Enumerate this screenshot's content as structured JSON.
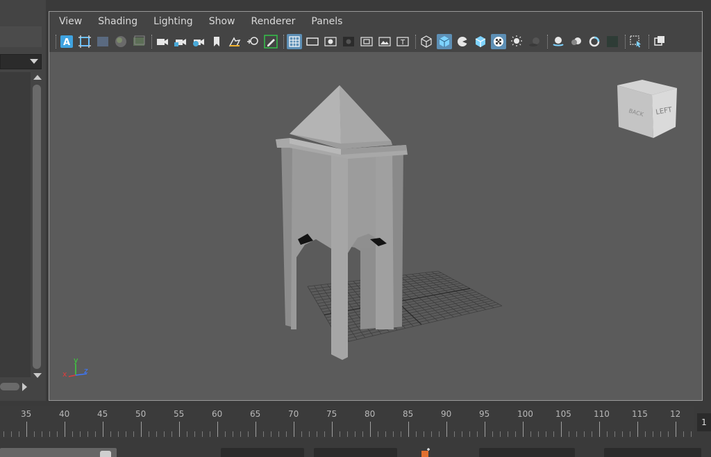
{
  "panel_menu": {
    "items": [
      "View",
      "Shading",
      "Lighting",
      "Show",
      "Renderer",
      "Panels"
    ]
  },
  "panel_toolbar": {
    "icons": [
      "select-camera-icon",
      "camera-attributes-icon",
      "bookmarks-icon",
      "image-plane-icon",
      "2d-pan-zoom-icon",
      "grease-pencil-icon",
      "grid-icon",
      "film-gate-icon",
      "resolution-gate-icon",
      "gate-mask-icon",
      "field-chart-icon",
      "safe-action-icon",
      "safe-title-icon",
      "wireframe-icon",
      "smooth-shade-icon",
      "use-default-material-icon",
      "wireframe-on-shaded-icon",
      "textured-icon",
      "use-all-lights-icon",
      "shadows-icon",
      "screen-space-ao-icon",
      "motion-blur-icon",
      "anti-aliasing-icon",
      "depth-of-field-icon",
      "isolate-select-icon",
      "xray-icon"
    ]
  },
  "view_cube": {
    "face_left": "LEFT",
    "face_back": "BACK"
  },
  "axis_gizmo": {
    "x": "x",
    "y": "y",
    "z": "z"
  },
  "timeline": {
    "labels": [
      "35",
      "40",
      "45",
      "50",
      "55",
      "60",
      "65",
      "70",
      "75",
      "80",
      "85",
      "90",
      "95",
      "100",
      "105",
      "110",
      "115",
      "12"
    ],
    "current_frame": "1"
  },
  "colors": {
    "viewport_bg": "#5b5b5b",
    "panel_bg": "#444444",
    "active_icon": "#5d8fb5",
    "grease_pencil_green": "#34c24a",
    "axis_x": "#e03c3c",
    "axis_y": "#3cd23c",
    "axis_z": "#3c78ff"
  }
}
